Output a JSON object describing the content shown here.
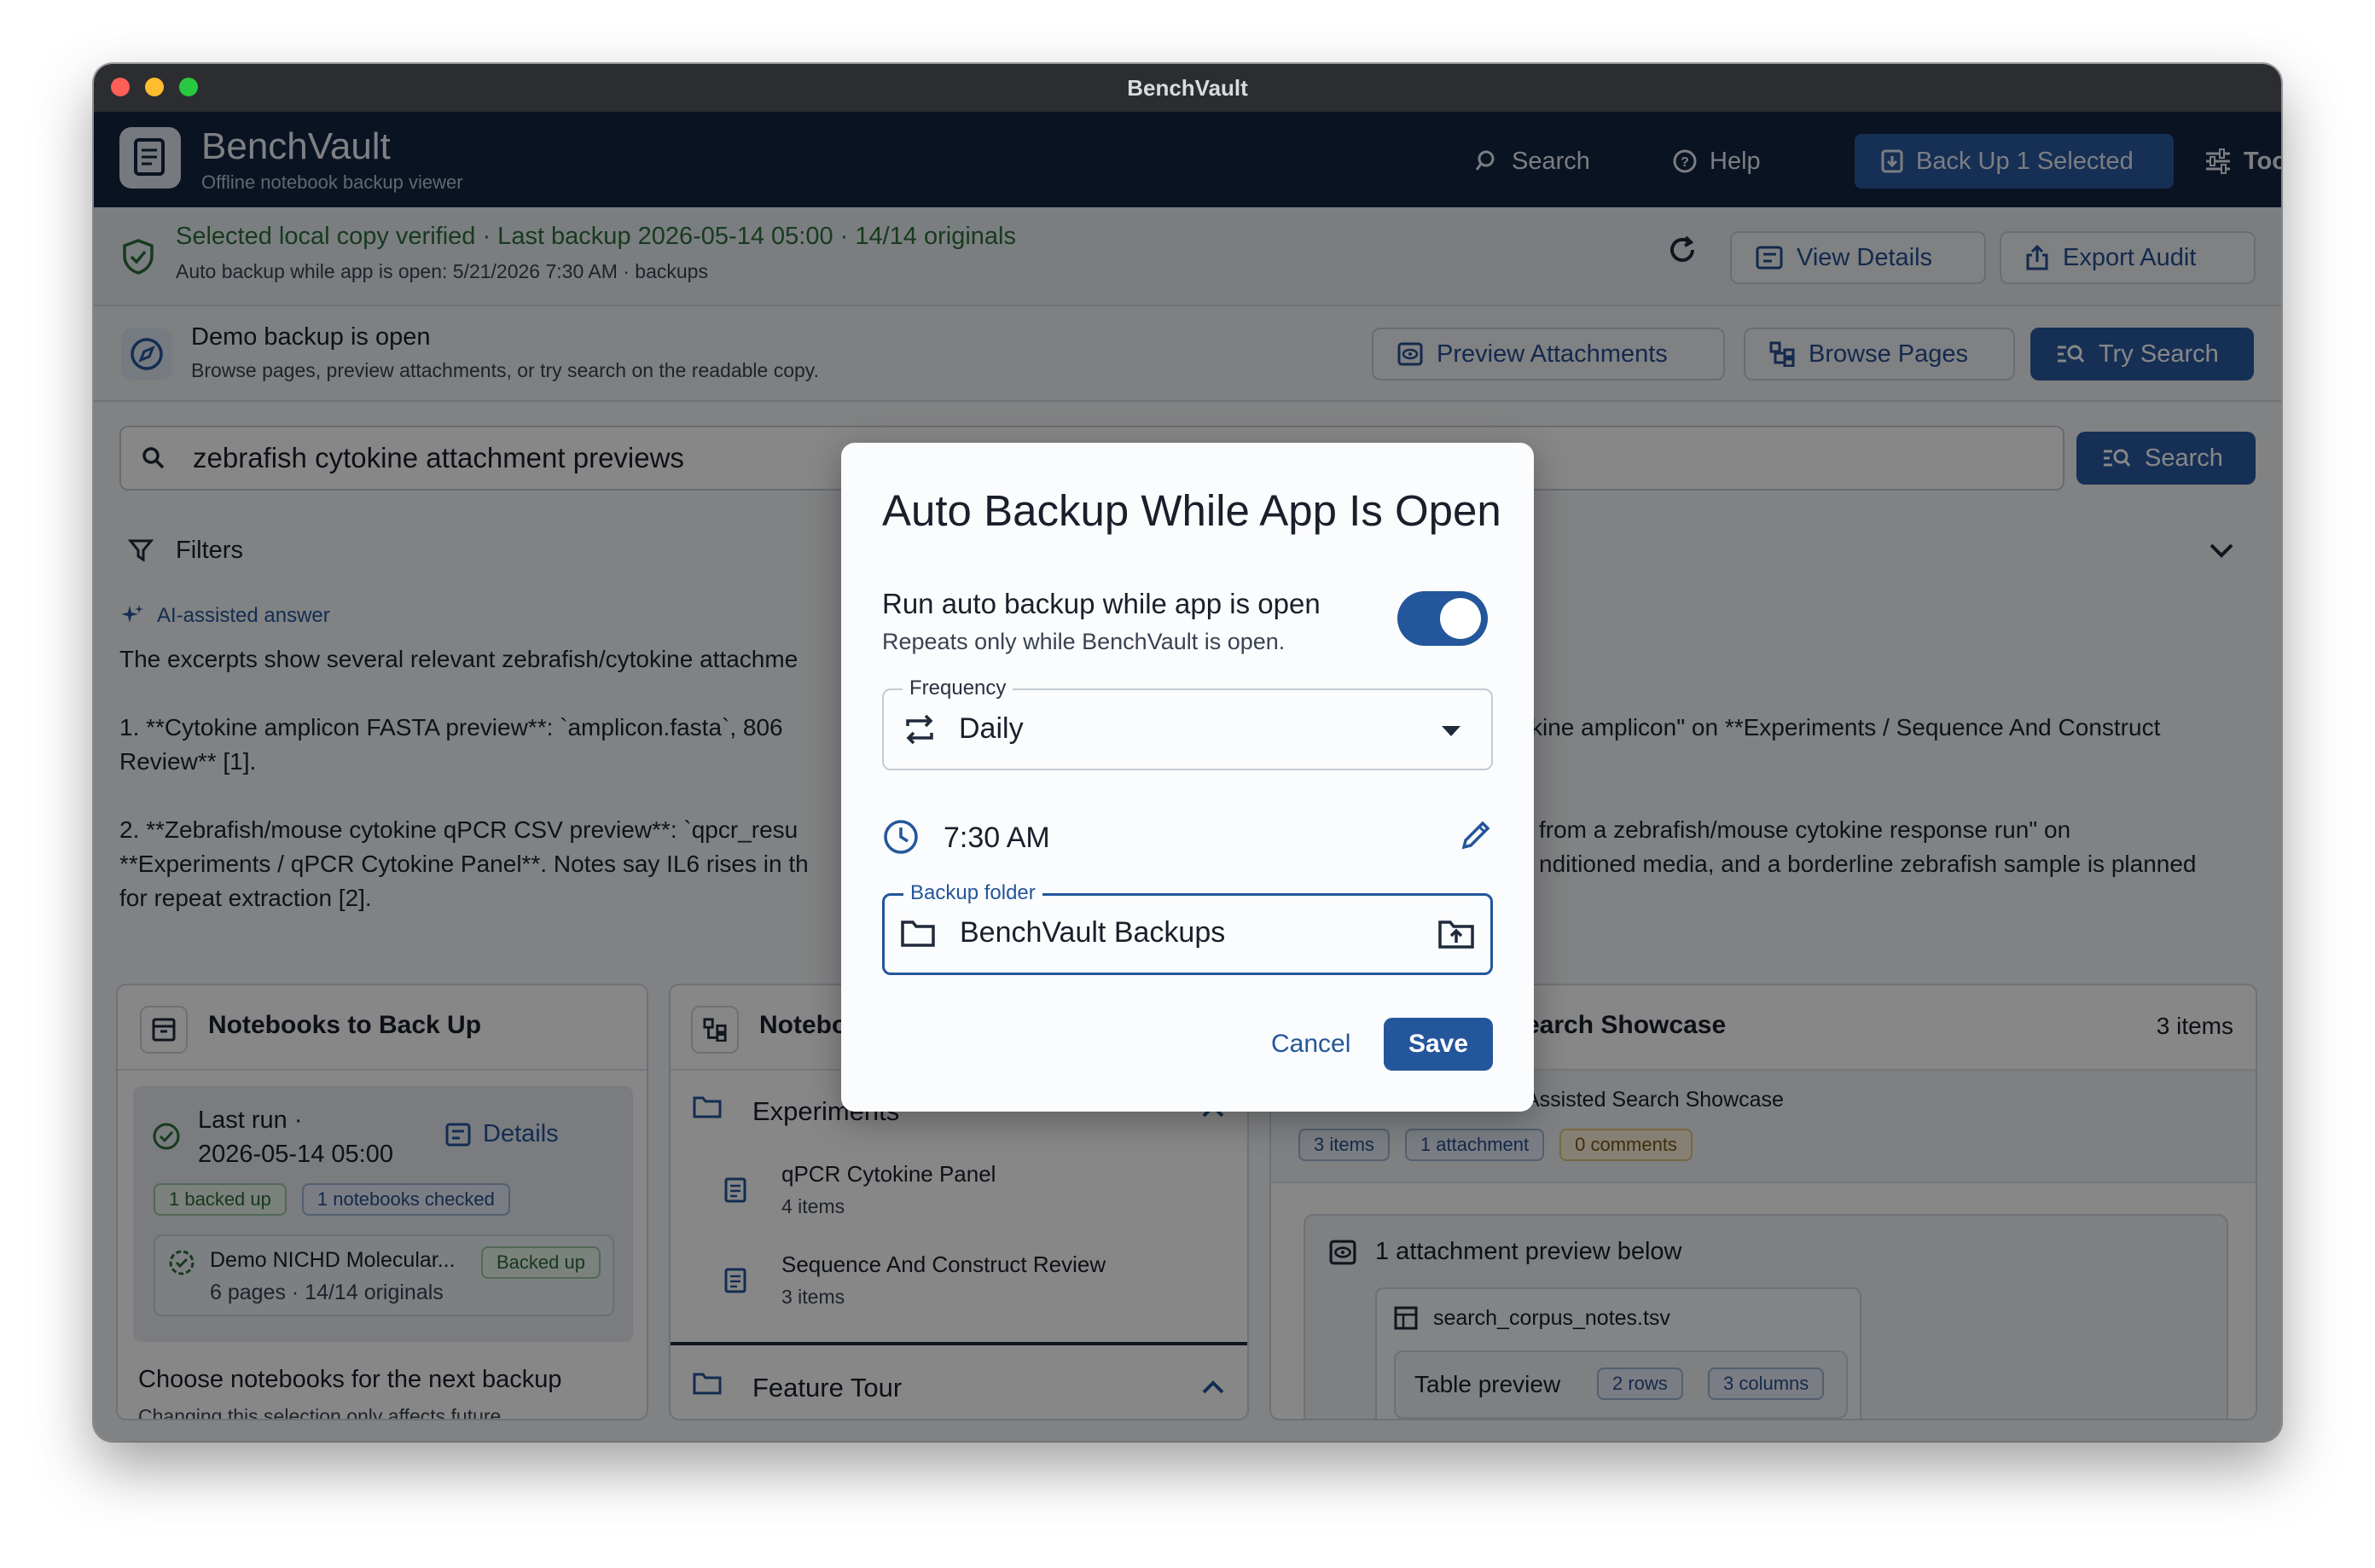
{
  "window": {
    "title": "BenchVault"
  },
  "header": {
    "app_name": "BenchVault",
    "app_subtitle": "Offline notebook backup viewer",
    "search_label": "Search",
    "help_label": "Help",
    "backup_label": "Back Up 1 Selected",
    "tools_label": "Tools"
  },
  "status": {
    "main": "Selected local copy verified · Last backup 2026-05-14 05:00 · 14/14 originals",
    "sub": "Auto backup while app is open: 5/21/2026 7:30 AM · backups",
    "view_details_label": "View Details",
    "export_audit_label": "Export Audit"
  },
  "demo": {
    "title": "Demo backup is open",
    "subtitle": "Browse pages, preview attachments, or try search on the readable copy.",
    "preview_label": "Preview Attachments",
    "browse_label": "Browse Pages",
    "try_search_label": "Try Search"
  },
  "search": {
    "query": "zebrafish cytokine attachment previews",
    "button_label": "Search",
    "filters_label": "Filters"
  },
  "answer": {
    "badge": "AI-assisted answer",
    "intro": "The excerpts show several relevant zebrafish/cytokine attachme",
    "item1_left": "1. **Cytokine amplicon FASTA preview**: `amplicon.fasta`, 806",
    "item1_right": "kine amplicon\" on **Experiments / Sequence And Construct",
    "item1_line2": "Review** [1].",
    "item2_left": "2. **Zebrafish/mouse cytokine qPCR CSV preview**: `qpcr_resu",
    "item2_right": "from a zebrafish/mouse cytokine response run\" on",
    "item2_line2_left": "**Experiments / qPCR Cytokine Panel**. Notes say IL6 rises in th",
    "item2_line2_right": "nditioned media, and a borderline zebrafish sample is planned",
    "item2_line3": "for repeat extraction [2]."
  },
  "panel_notebooks": {
    "title": "Notebooks to Back Up",
    "last_run_label": "Last run ·",
    "last_run_time": "2026-05-14 05:00",
    "details_label": "Details",
    "chip_backed": "1 backed up",
    "chip_checked": "1 notebooks checked",
    "nb_name": "Demo NICHD Molecular...",
    "nb_meta": "6 pages · 14/14 originals",
    "nb_badge": "Backed up",
    "choose_title": "Choose notebooks for the next backup",
    "choose_sub": "Changing this selection only affects future"
  },
  "panel_tree": {
    "title": "Notebo",
    "group1": "Experiments",
    "item1_name": "qPCR Cytokine Panel",
    "item1_meta": "4 items",
    "item2_name": "Sequence And Construct Review",
    "item2_meta": "3 items",
    "group2": "Feature Tour"
  },
  "panel_showcase": {
    "title": "earch Showcase",
    "count": "3 items",
    "subtitle": "Assisted Search Showcase",
    "chip_items": "3 items",
    "chip_attach": "1 attachment",
    "chip_comments": "0 comments",
    "preview_title": "1 attachment preview below",
    "file_name": "search_corpus_notes.tsv",
    "table_label": "Table preview",
    "chip_rows": "2 rows",
    "chip_cols": "3 columns"
  },
  "dialog": {
    "title": "Auto Backup While App Is Open",
    "toggle_label": "Run auto backup while app is open",
    "toggle_help": "Repeats only while BenchVault is open.",
    "toggle_on": true,
    "frequency_legend": "Frequency",
    "frequency_value": "Daily",
    "time_value": "7:30 AM",
    "folder_legend": "Backup folder",
    "folder_value": "BenchVault Backups",
    "cancel_label": "Cancel",
    "save_label": "Save"
  },
  "colors": {
    "header_bg": "#14243f",
    "accent": "#24569b",
    "verified_green": "#2c6f3b"
  }
}
